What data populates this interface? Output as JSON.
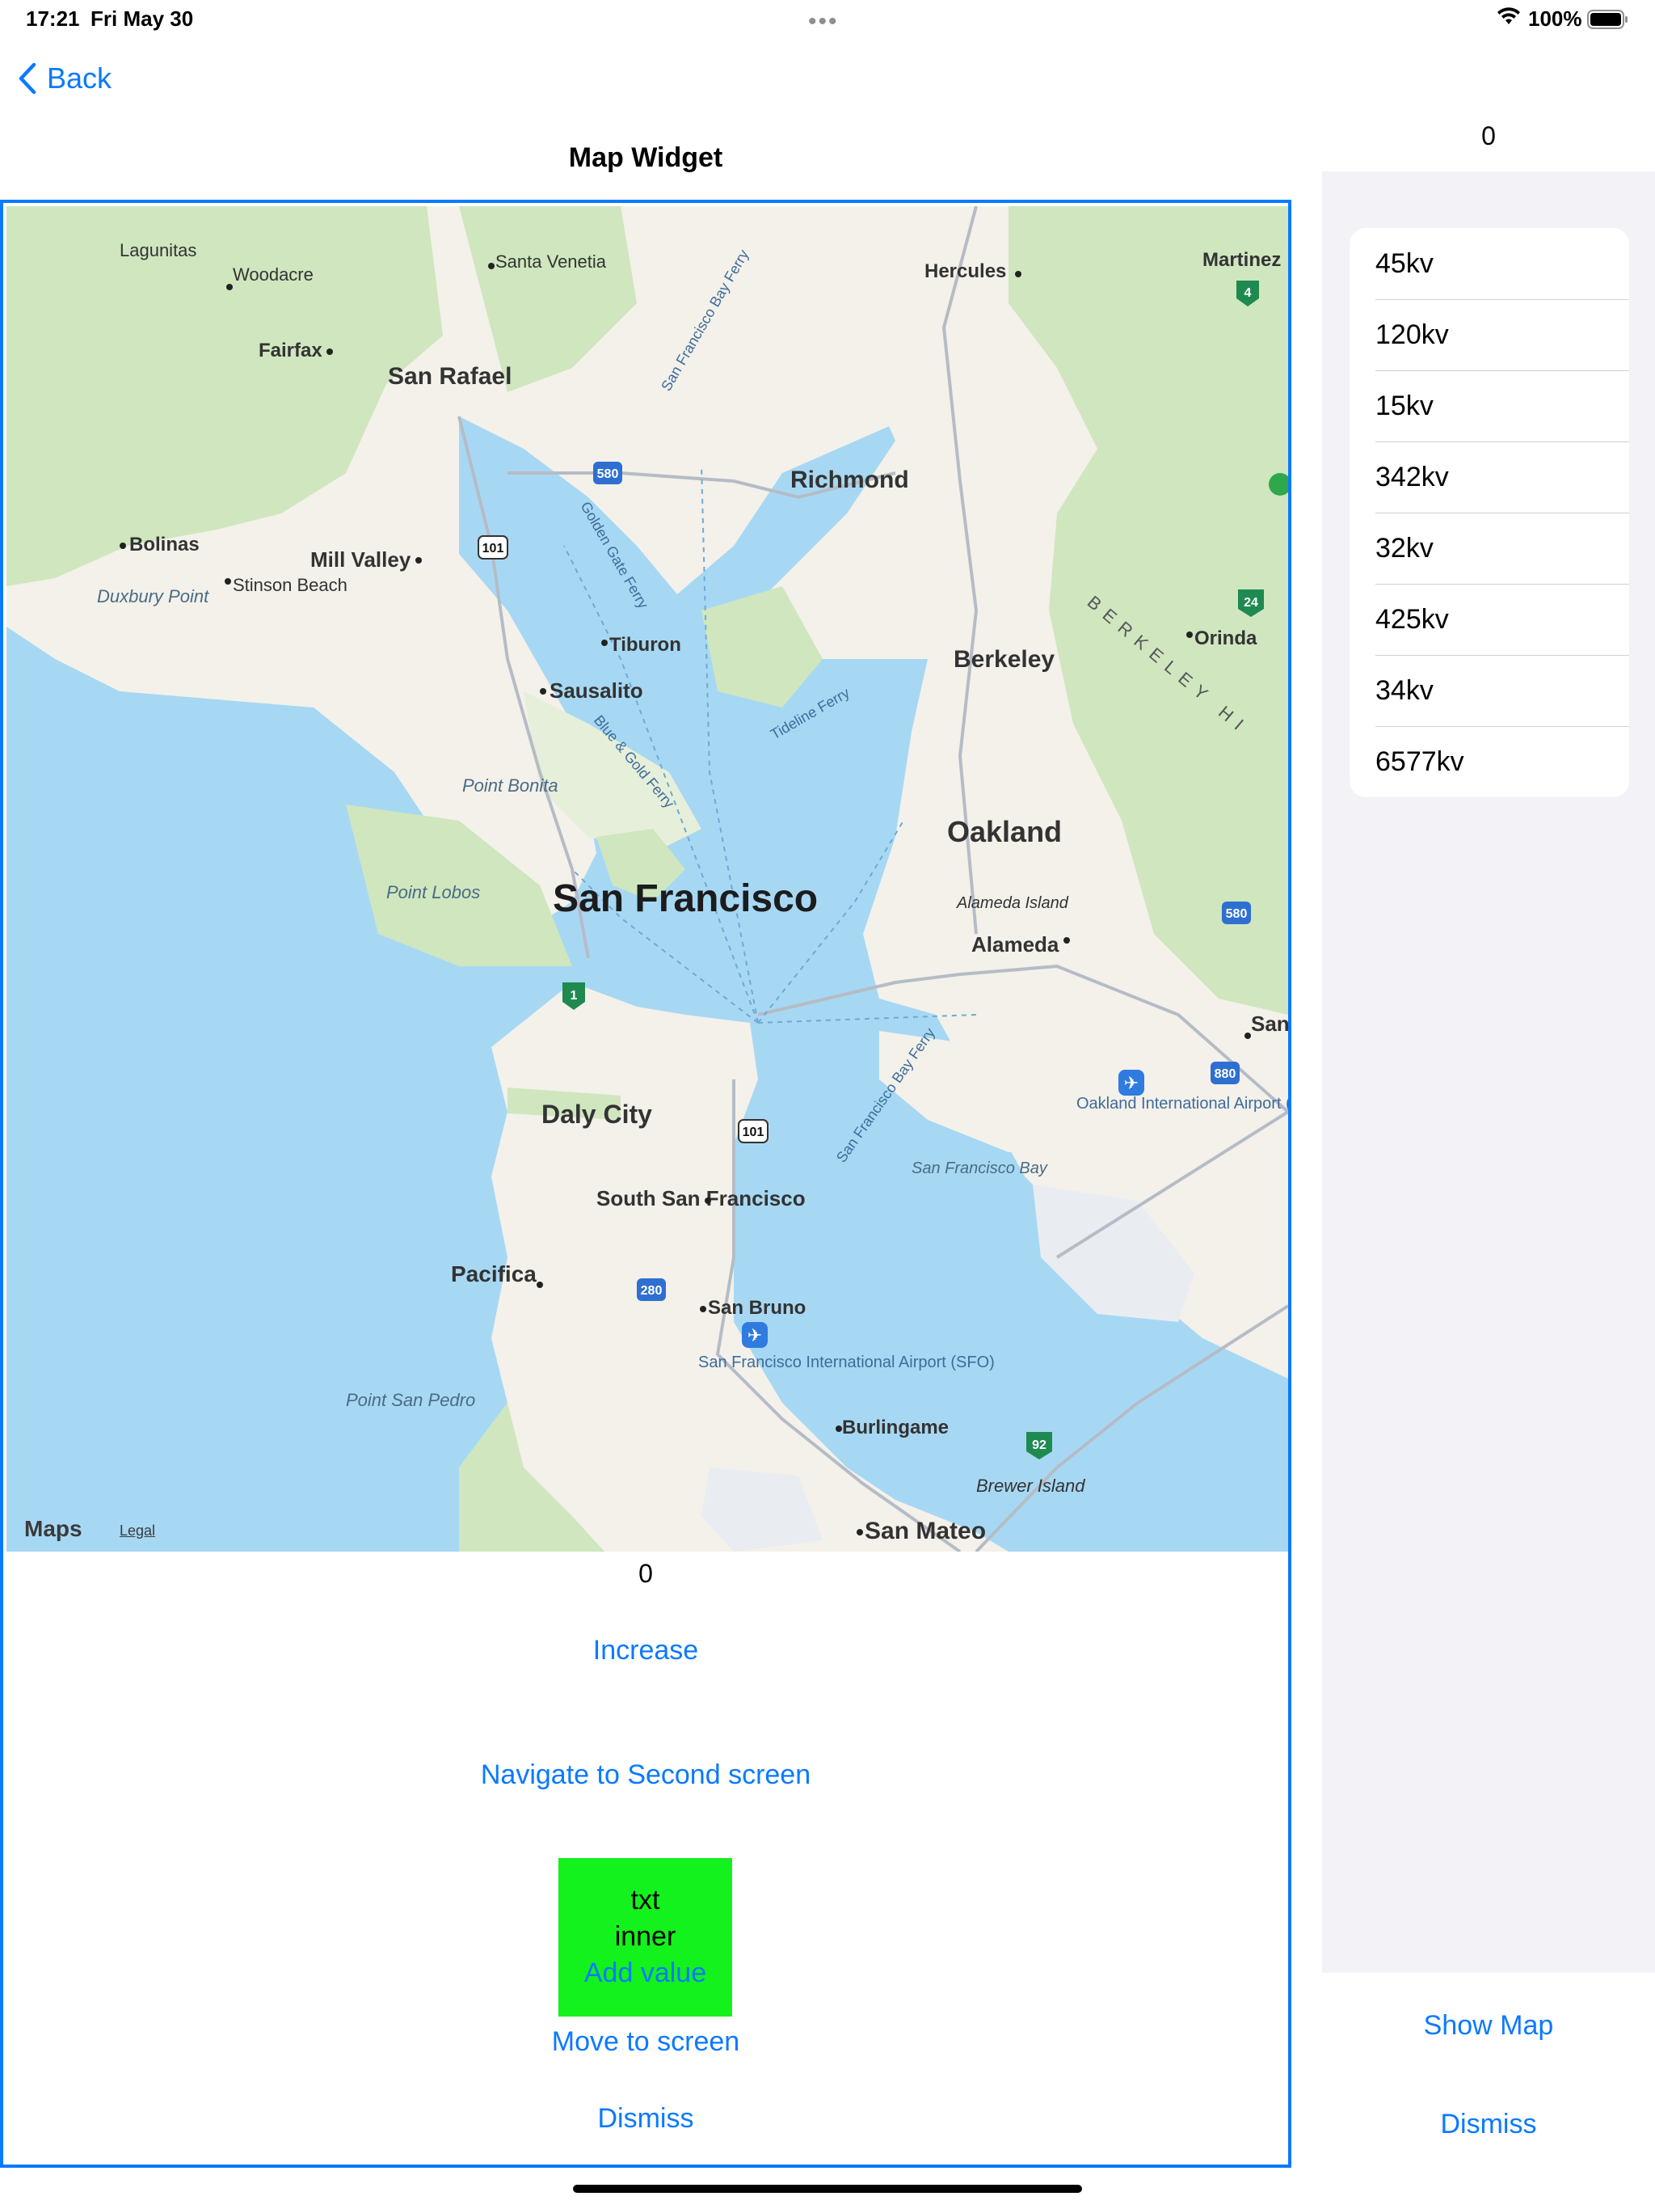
{
  "status_bar": {
    "time": "17:21",
    "date": "Fri May 30",
    "battery_pct": "100%"
  },
  "nav": {
    "back_label": "Back",
    "title": "Map Widget"
  },
  "map": {
    "attribution": "Maps",
    "legal": "Legal",
    "labels": {
      "lagunitas": "Lagunitas",
      "woodacre": "Woodacre",
      "santa_venetia": "Santa Venetia",
      "hercules": "Hercules",
      "martinez": "Martinez",
      "fairfax": "Fairfax",
      "san_rafael": "San Rafael",
      "richmond": "Richmond",
      "bolinas": "Bolinas",
      "mill_valley": "Mill Valley",
      "stinson_beach": "Stinson Beach",
      "duxbury_point": "Duxbury Point",
      "tiburon": "Tiburon",
      "sausalito": "Sausalito",
      "berkeley": "Berkeley",
      "orinda": "Orinda",
      "berkeley_hills": "BERKELEY HI",
      "point_bonita": "Point Bonita",
      "oakland": "Oakland",
      "point_lobos": "Point Lobos",
      "san_francisco": "San Francisco",
      "alameda_island": "Alameda Island",
      "alameda": "Alameda",
      "san_leandro": "San",
      "oakland_airport": "Oakland International Airport (OAK)",
      "daly_city": "Daly City",
      "sf_bay": "San Francisco Bay",
      "south_sf": "South San Francisco",
      "pacifica": "Pacifica",
      "san_bruno": "San Bruno",
      "sfo": "San Francisco International Airport (SFO)",
      "point_san_pedro": "Point San Pedro",
      "burlingame": "Burlingame",
      "brewer_island": "Brewer Island",
      "san_mateo": "San Mateo",
      "golden_gate_ferry": "Golden Gate Ferry",
      "sf_bay_ferry_top": "San Francisco Bay Ferry",
      "tideline_ferry": "Tideline Ferry",
      "blue_gold_ferry": "Blue & Gold Ferry",
      "sf_bay_ferry_mid": "San Francisco Bay Ferry"
    },
    "shields": {
      "i580_north": "580",
      "us101_north": "101",
      "ca4": "4",
      "ca24": "24",
      "ca1": "1",
      "us101_south": "101",
      "i580_east": "580",
      "i880": "880",
      "i280": "280",
      "ca92": "92"
    }
  },
  "main": {
    "counter": "0",
    "increase_label": "Increase",
    "navigate_label": "Navigate to Second screen",
    "box": {
      "line1": "txt",
      "line2": "inner",
      "add_label": "Add value"
    },
    "move_label": "Move to screen",
    "dismiss_label": "Dismiss"
  },
  "side": {
    "counter": "0",
    "items": [
      "45kv",
      "120kv",
      "15kv",
      "342kv",
      "32kv",
      "425kv",
      "34kv",
      "6577kv"
    ],
    "show_map_label": "Show Map",
    "dismiss_label": "Dismiss"
  },
  "colors": {
    "accent": "#0a7aff",
    "green_box": "#13f21c",
    "water": "#a7d8f3",
    "land": "#f3f1ea",
    "park": "#cfe6bf"
  }
}
